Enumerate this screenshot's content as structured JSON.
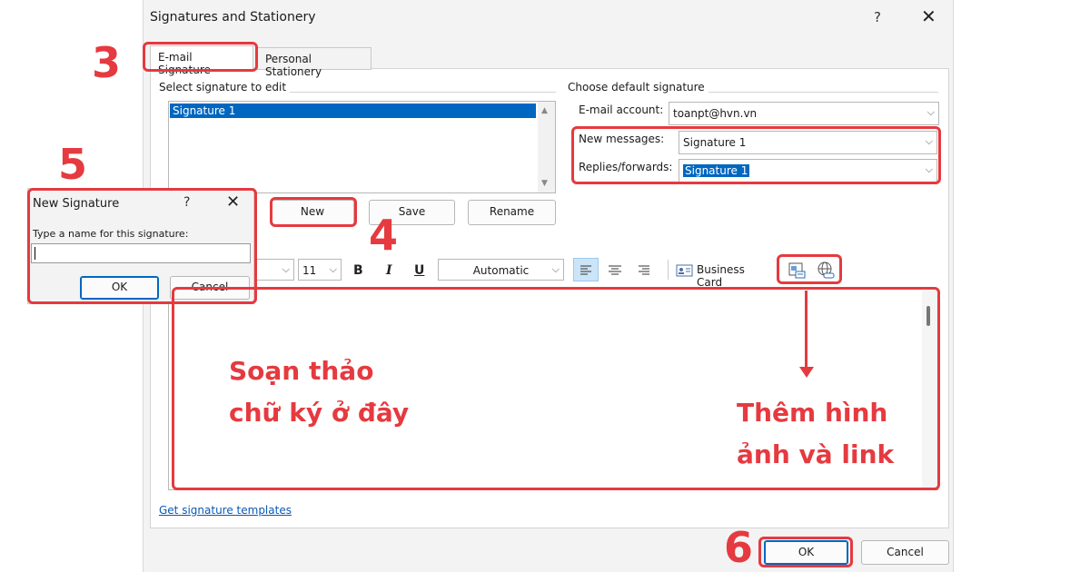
{
  "dialog": {
    "title": "Signatures and Stationery",
    "help": "?",
    "close": "✕"
  },
  "tabs": {
    "email_signature": "E-mail Signature",
    "personal_stationery": "Personal Stationery"
  },
  "select_group": {
    "label": "Select signature to edit",
    "items": [
      "Signature 1"
    ],
    "up_arrow": "▲",
    "down_arrow": "▼"
  },
  "buttons": {
    "new": "New",
    "save": "Save",
    "rename": "Rename",
    "ok": "OK",
    "cancel": "Cancel"
  },
  "default_group": {
    "label": "Choose default signature",
    "email_account_label": "E-mail account:",
    "email_account_value": "toanpt@hvn.vn",
    "new_messages_label": "New messages:",
    "new_messages_value": "Signature 1",
    "replies_label": "Replies/forwards:",
    "replies_value": "Signature 1",
    "chevron": "⌵"
  },
  "toolbar": {
    "font_size": "11",
    "bold": "B",
    "italic": "I",
    "underline": "U",
    "color": "Automatic",
    "business_card": "Business Card"
  },
  "footer": {
    "templates_link": "Get signature templates"
  },
  "annotations": {
    "step3": "3",
    "step4": "4",
    "step5": "5",
    "step6": "6",
    "compose_line1": "Soạn thảo",
    "compose_line2": "chữ ký ở đây",
    "insert_line1": "Thêm hình",
    "insert_line2": "ảnh và link",
    "accent_color": "#e53a3f"
  },
  "new_signature_dialog": {
    "title": "New Signature",
    "help": "?",
    "close": "✕",
    "prompt": "Type a name for this signature:",
    "ok": "OK",
    "cancel": "Cancel"
  },
  "colors": {
    "selection": "#0067c0",
    "annotation": "#e53a3f",
    "link": "#0a58b5"
  }
}
